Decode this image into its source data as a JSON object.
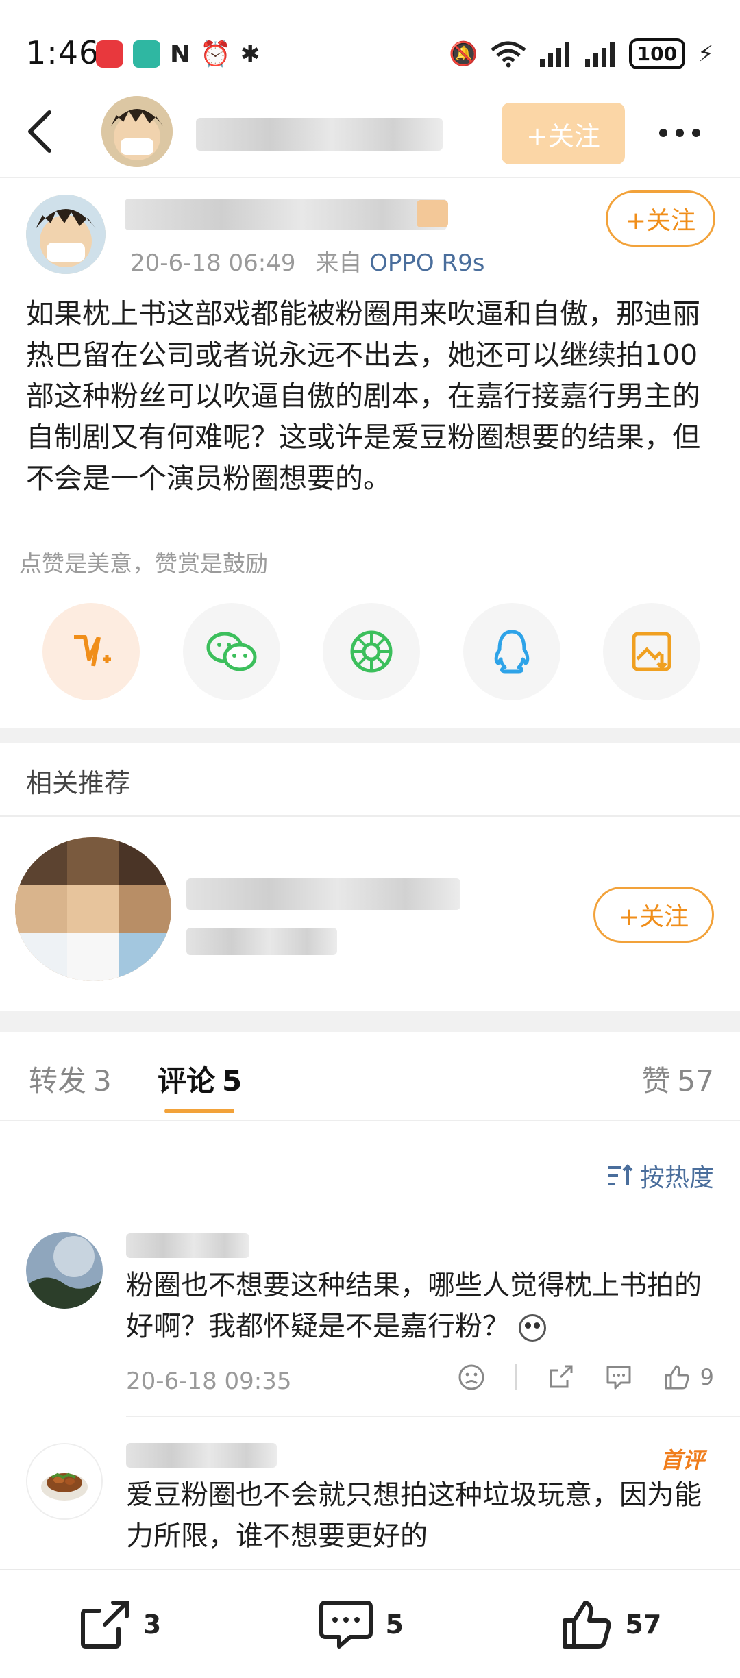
{
  "status_bar": {
    "time": "1:46",
    "battery": "100"
  },
  "header": {
    "follow_label": "+关注"
  },
  "post": {
    "meta_time": "20-6-18 06:49",
    "meta_from": "来自",
    "meta_device": "OPPO R9s",
    "follow_label": "+关注",
    "body": "如果枕上书这部戏都能被粉圈用来吹逼和自傲，那迪丽热巴留在公司或者说永远不出去，她还可以继续拍100部这种粉丝可以吹逼自傲的剧本，在嘉行接嘉行男主的自制剧又有何难呢？这或许是爱豆粉圈想要的结果，但不会是一个演员粉圈想要的。",
    "reward_tip": "点赞是美意，赞赏是鼓励"
  },
  "share_icons": [
    "reward-v-icon",
    "wechat-icon",
    "moments-icon",
    "qq-icon",
    "save-image-icon"
  ],
  "related": {
    "title": "相关推荐",
    "follow_label": "+关注"
  },
  "tabs": {
    "repost_label": "转发",
    "repost_count": "3",
    "comment_label": "评论",
    "comment_count": "5",
    "like_label": "赞",
    "like_count": "57"
  },
  "sort_label": "按热度",
  "comments": [
    {
      "text": "粉圈也不想要这种结果，哪些人觉得枕上书拍的好啊？我都怀疑是不是嘉行粉？",
      "time": "20-6-18 09:35",
      "likes": "9"
    },
    {
      "badge": "首评",
      "text": "爱豆粉圈也不会就只想拍这种垃圾玩意，因为能力所限，谁不想要更好的"
    }
  ],
  "bottom_bar": {
    "repost": "3",
    "comment": "5",
    "like": "57"
  },
  "colors": {
    "accent": "#f2a23a",
    "link": "#4a6e9c"
  }
}
